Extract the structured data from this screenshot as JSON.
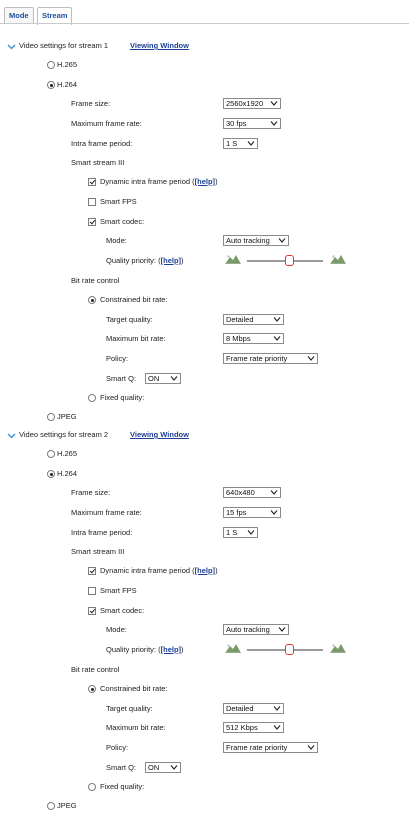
{
  "tabs": [
    {
      "label": "Mode"
    },
    {
      "label": "Stream"
    }
  ],
  "streams": [
    {
      "section_label": "Video settings for stream 1",
      "viewing_window_link": "Viewing Window",
      "codecs": {
        "h265": "H.265",
        "h264": "H.264",
        "jpeg": "JPEG"
      },
      "selected_codec": "H.264",
      "frame_size": {
        "label": "Frame size:",
        "value": "2560x1920"
      },
      "max_frame_rate": {
        "label": "Maximum frame rate:",
        "value": "30 fps"
      },
      "intra_frame_period": {
        "label": "Intra frame period:",
        "value": "1 S"
      },
      "smart_stream_title": "Smart stream III",
      "dynamic_intra": {
        "label": "Dynamic intra frame period",
        "help_prefix": "(",
        "help": "[help]",
        "help_suffix": ")",
        "checked": true
      },
      "smart_fps": {
        "label": "Smart FPS",
        "checked": false
      },
      "smart_codec": {
        "label": "Smart codec:",
        "checked": true
      },
      "mode": {
        "label": "Mode:",
        "value": "Auto tracking"
      },
      "quality_priority": {
        "label": "Quality priority:",
        "help_prefix": "(",
        "help": "[help]",
        "help_suffix": ")",
        "level": 0.55
      },
      "bit_rate_title": "Bit rate control",
      "constrained": {
        "label": "Constrained bit rate:",
        "selected": true
      },
      "target_quality": {
        "label": "Target quality:",
        "value": "Detailed"
      },
      "max_bit_rate": {
        "label": "Maximum bit rate:",
        "value": "8 Mbps"
      },
      "policy": {
        "label": "Policy:",
        "value": "Frame rate priority"
      },
      "smart_q": {
        "label": "Smart Q:",
        "value": "ON"
      },
      "fixed_quality": {
        "label": "Fixed quality:",
        "selected": false
      }
    },
    {
      "section_label": "Video settings for stream 2",
      "viewing_window_link": "Viewing Window",
      "codecs": {
        "h265": "H.265",
        "h264": "H.264",
        "jpeg": "JPEG"
      },
      "selected_codec": "H.264",
      "frame_size": {
        "label": "Frame size:",
        "value": "640x480"
      },
      "max_frame_rate": {
        "label": "Maximum frame rate:",
        "value": "15 fps"
      },
      "intra_frame_period": {
        "label": "Intra frame period:",
        "value": "1 S"
      },
      "smart_stream_title": "Smart stream III",
      "dynamic_intra": {
        "label": "Dynamic intra frame period",
        "help_prefix": "(",
        "help": "[help]",
        "help_suffix": ")",
        "checked": true
      },
      "smart_fps": {
        "label": "Smart FPS",
        "checked": false
      },
      "smart_codec": {
        "label": "Smart codec:",
        "checked": true
      },
      "mode": {
        "label": "Mode:",
        "value": "Auto tracking"
      },
      "quality_priority": {
        "label": "Quality priority:",
        "help_prefix": "(",
        "help": "[help]",
        "help_suffix": ")",
        "level": 0.55
      },
      "bit_rate_title": "Bit rate control",
      "constrained": {
        "label": "Constrained bit rate:",
        "selected": true
      },
      "target_quality": {
        "label": "Target quality:",
        "value": "Detailed"
      },
      "max_bit_rate": {
        "label": "Maximum bit rate:",
        "value": "512 Kbps"
      },
      "policy": {
        "label": "Policy:",
        "value": "Frame rate priority"
      },
      "smart_q": {
        "label": "Smart Q:",
        "value": "ON"
      },
      "fixed_quality": {
        "label": "Fixed quality:",
        "selected": false
      }
    }
  ],
  "colors": {
    "link": "#1d3f96",
    "accent": "#3a8bd8",
    "slider_handle": "#e03b2a"
  },
  "icons": {
    "section_toggle": "chevron-down-icon",
    "quality_low": "mountain-low-icon",
    "quality_high": "mountain-high-icon",
    "select_caret": "caret-down-icon"
  }
}
